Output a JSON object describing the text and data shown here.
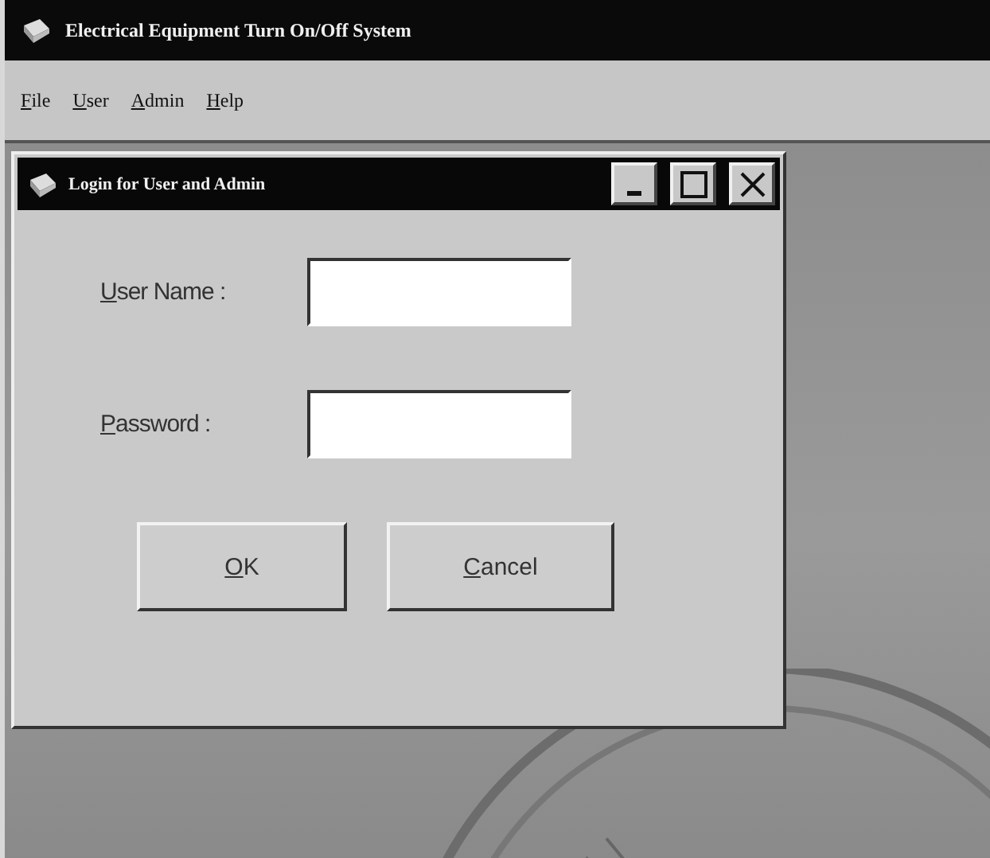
{
  "window": {
    "title": "Electrical Equipment Turn On/Off System"
  },
  "menu": [
    {
      "label": "File",
      "mnemonic_underlined": true
    },
    {
      "label": "User",
      "mnemonic_underlined": true
    },
    {
      "label": "Admin",
      "mnemonic_underlined": true
    },
    {
      "label": "Help",
      "mnemonic_underlined": true
    }
  ],
  "dialog": {
    "title": "Login for User and Admin",
    "fields": [
      {
        "label": "User Name :",
        "mnemonic_underlined": true
      },
      {
        "label": "Password :",
        "mnemonic_underlined": true
      }
    ],
    "buttons": [
      {
        "label": "OK",
        "mnemonic_underlined": true
      },
      {
        "label": "Cancel",
        "mnemonic_underlined": true
      }
    ]
  }
}
